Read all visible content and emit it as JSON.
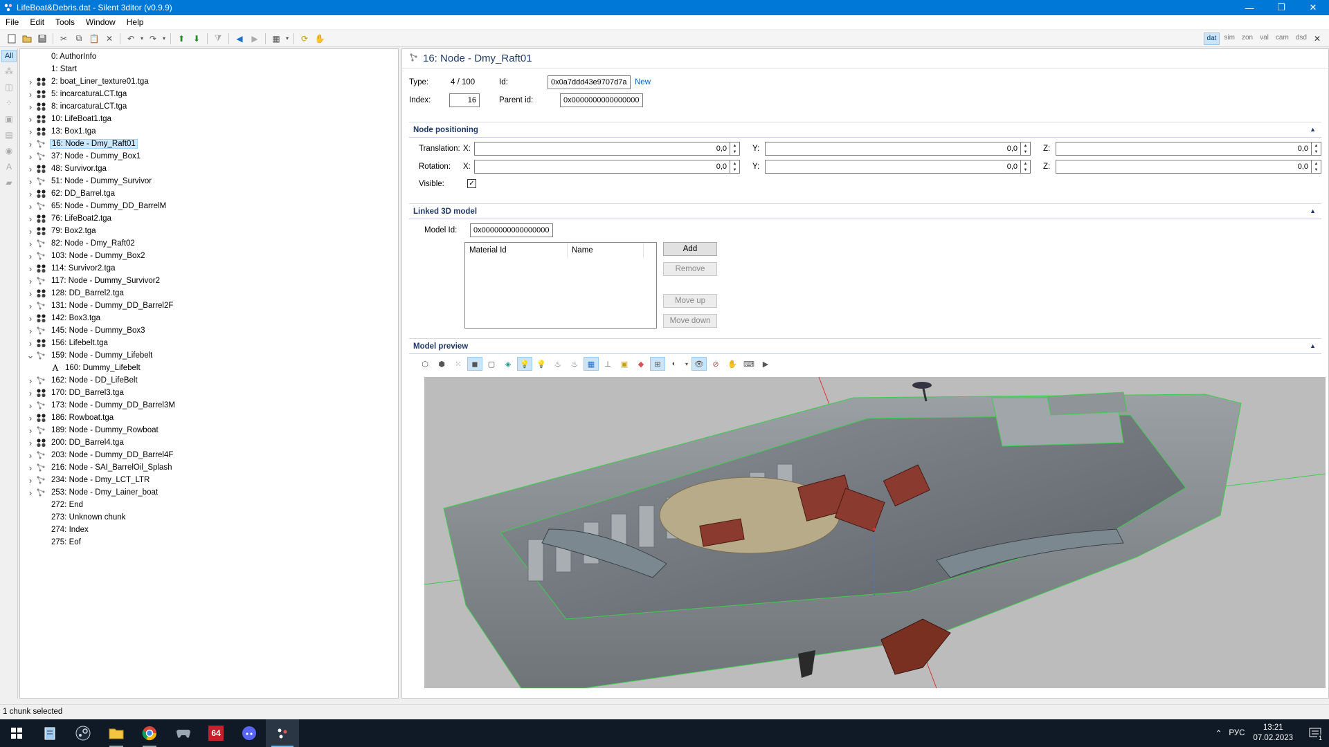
{
  "window": {
    "title": "LifeBoat&Debris.dat - Silent 3ditor (v0.9.9)",
    "controls": {
      "minimize": "—",
      "restore": "❐",
      "close": "✕"
    }
  },
  "menu": [
    "File",
    "Edit",
    "Tools",
    "Window",
    "Help"
  ],
  "toolbar_right": [
    "dat",
    "sim",
    "zon",
    "val",
    "cam",
    "dsd"
  ],
  "toolbar_right_active": "dat",
  "toolbar_close": "✕",
  "left_strip": {
    "all_label": "All"
  },
  "tree": [
    {
      "label": "0: AuthorInfo",
      "icon": "none",
      "expander": "none"
    },
    {
      "label": "1: Start",
      "icon": "none",
      "expander": "none"
    },
    {
      "label": "2: boat_Liner_texture01.tga",
      "icon": "texture",
      "expander": "collapsed"
    },
    {
      "label": "5: incarcaturaLCT.tga",
      "icon": "texture",
      "expander": "collapsed"
    },
    {
      "label": "8: incarcaturaLCT.tga",
      "icon": "texture",
      "expander": "collapsed"
    },
    {
      "label": "10: LifeBoat1.tga",
      "icon": "texture",
      "expander": "collapsed"
    },
    {
      "label": "13: Box1.tga",
      "icon": "texture",
      "expander": "collapsed"
    },
    {
      "label": "16: Node - Dmy_Raft01",
      "icon": "node",
      "expander": "collapsed",
      "selected": true
    },
    {
      "label": "37: Node - Dummy_Box1",
      "icon": "node",
      "expander": "collapsed"
    },
    {
      "label": "48: Survivor.tga",
      "icon": "texture",
      "expander": "collapsed"
    },
    {
      "label": "51: Node - Dummy_Survivor",
      "icon": "node",
      "expander": "collapsed"
    },
    {
      "label": "62: DD_Barrel.tga",
      "icon": "texture",
      "expander": "collapsed"
    },
    {
      "label": "65: Node - Dummy_DD_BarrelM",
      "icon": "node",
      "expander": "collapsed"
    },
    {
      "label": "76: LifeBoat2.tga",
      "icon": "texture",
      "expander": "collapsed"
    },
    {
      "label": "79: Box2.tga",
      "icon": "texture",
      "expander": "collapsed"
    },
    {
      "label": "82: Node - Dmy_Raft02",
      "icon": "node",
      "expander": "collapsed"
    },
    {
      "label": "103: Node - Dummy_Box2",
      "icon": "node",
      "expander": "collapsed"
    },
    {
      "label": "114: Survivor2.tga",
      "icon": "texture",
      "expander": "collapsed"
    },
    {
      "label": "117: Node - Dummy_Survivor2",
      "icon": "node",
      "expander": "collapsed"
    },
    {
      "label": "128: DD_Barrel2.tga",
      "icon": "texture",
      "expander": "collapsed"
    },
    {
      "label": "131: Node - Dummy_DD_Barrel2F",
      "icon": "node",
      "expander": "collapsed"
    },
    {
      "label": "142: Box3.tga",
      "icon": "texture",
      "expander": "collapsed"
    },
    {
      "label": "145: Node - Dummy_Box3",
      "icon": "node",
      "expander": "collapsed"
    },
    {
      "label": "156: Lifebelt.tga",
      "icon": "texture",
      "expander": "collapsed"
    },
    {
      "label": "159: Node - Dummy_Lifebelt",
      "icon": "node",
      "expander": "expanded"
    },
    {
      "label": "160: Dummy_Lifebelt",
      "icon": "text",
      "expander": "none",
      "child": true
    },
    {
      "label": "162: Node - DD_LifeBelt",
      "icon": "node",
      "expander": "collapsed"
    },
    {
      "label": "170: DD_Barrel3.tga",
      "icon": "texture",
      "expander": "collapsed"
    },
    {
      "label": "173: Node - Dummy_DD_Barrel3M",
      "icon": "node",
      "expander": "collapsed"
    },
    {
      "label": "186: Rowboat.tga",
      "icon": "texture",
      "expander": "collapsed"
    },
    {
      "label": "189: Node - Dummy_Rowboat",
      "icon": "node",
      "expander": "collapsed"
    },
    {
      "label": "200: DD_Barrel4.tga",
      "icon": "texture",
      "expander": "collapsed"
    },
    {
      "label": "203: Node - Dummy_DD_Barrel4F",
      "icon": "node",
      "expander": "collapsed"
    },
    {
      "label": "216: Node - SAI_BarrelOil_Splash",
      "icon": "node",
      "expander": "collapsed"
    },
    {
      "label": "234: Node - Dmy_LCT_LTR",
      "icon": "node",
      "expander": "collapsed"
    },
    {
      "label": "253: Node - Dmy_Lainer_boat",
      "icon": "node",
      "expander": "collapsed"
    },
    {
      "label": "272: End",
      "icon": "none",
      "expander": "none"
    },
    {
      "label": "273: Unknown chunk",
      "icon": "none",
      "expander": "none"
    },
    {
      "label": "274: Index",
      "icon": "none",
      "expander": "none"
    },
    {
      "label": "275: Eof",
      "icon": "none",
      "expander": "none"
    }
  ],
  "detail": {
    "header": "16: Node - Dmy_Raft01",
    "type_label": "Type:",
    "type_value": "4 / 100",
    "id_label": "Id:",
    "id_value": "0x0a7ddd43e9707d7a",
    "new_link": "New",
    "index_label": "Index:",
    "index_value": "16",
    "parent_label": "Parent id:",
    "parent_value": "0x0000000000000000"
  },
  "positioning": {
    "title": "Node positioning",
    "translation_label": "Translation:",
    "rotation_label": "Rotation:",
    "visible_label": "Visible:",
    "visible_checked": "✓",
    "x_label": "X:",
    "y_label": "Y:",
    "z_label": "Z:",
    "translation": {
      "x": "0,0",
      "y": "0,0",
      "z": "0,0"
    },
    "rotation": {
      "x": "0,0",
      "y": "0,0",
      "z": "0,0"
    }
  },
  "linked_model": {
    "title": "Linked 3D model",
    "model_id_label": "Model Id:",
    "model_id_value": "0x0000000000000000",
    "col_material": "Material Id",
    "col_name": "Name",
    "add": "Add",
    "remove": "Remove",
    "move_up": "Move up",
    "move_down": "Move down"
  },
  "preview": {
    "title": "Model preview"
  },
  "collapse_glyph": "▲",
  "status": "1 chunk selected",
  "taskbar": {
    "lang": "РУС",
    "time": "13:21",
    "date": "07.02.2023",
    "notif_count": "1",
    "badge_64": "64"
  }
}
